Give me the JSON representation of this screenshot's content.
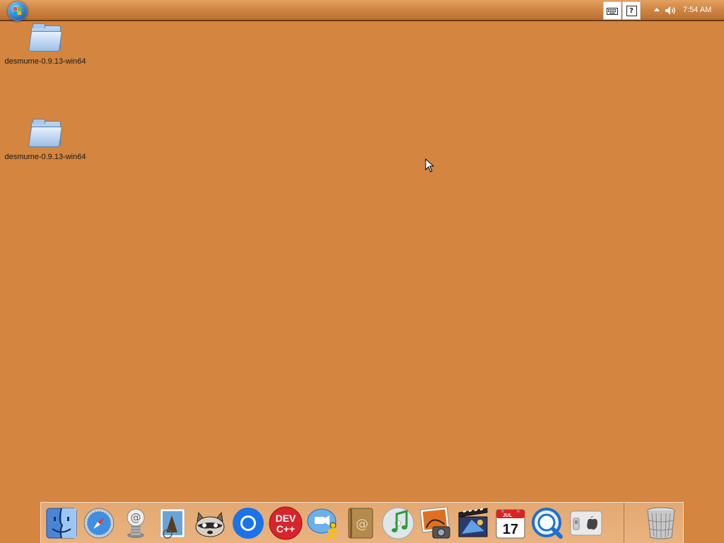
{
  "taskbar": {
    "clock": "7:54 AM",
    "tray_icons": [
      "keyboard-icon",
      "help-icon",
      "show-hidden-icons-arrow",
      "volume-icon"
    ]
  },
  "desktop": {
    "background_color": "#d4853f",
    "icons": [
      {
        "label": "desmume-0.9.13-win64",
        "icon": "folder-icon"
      },
      {
        "label": "desmume-0.9.13-win64",
        "icon": "folder-icon"
      }
    ]
  },
  "dock": {
    "items": [
      {
        "name": "finder",
        "icon": "finder-icon"
      },
      {
        "name": "safari",
        "icon": "safari-icon"
      },
      {
        "name": "mail-at",
        "icon": "at-mail-icon"
      },
      {
        "name": "mail-stamp",
        "icon": "mail-stamp-icon"
      },
      {
        "name": "raccoon",
        "icon": "raccoon-icon"
      },
      {
        "name": "chromium",
        "icon": "chromium-icon"
      },
      {
        "name": "dev-cpp",
        "icon": "devcpp-icon",
        "text": "DEV C++"
      },
      {
        "name": "aim",
        "icon": "aim-messenger-icon"
      },
      {
        "name": "address-book",
        "icon": "address-book-icon"
      },
      {
        "name": "itunes",
        "icon": "itunes-icon"
      },
      {
        "name": "iphoto",
        "icon": "iphoto-icon"
      },
      {
        "name": "imovie",
        "icon": "imovie-icon"
      },
      {
        "name": "ical",
        "icon": "calendar-icon",
        "month": "JUL",
        "day": "17"
      },
      {
        "name": "quicktime",
        "icon": "quicktime-icon"
      },
      {
        "name": "boot-camp",
        "icon": "apple-switch-icon"
      },
      {
        "name": "trash",
        "icon": "trash-icon"
      }
    ]
  }
}
